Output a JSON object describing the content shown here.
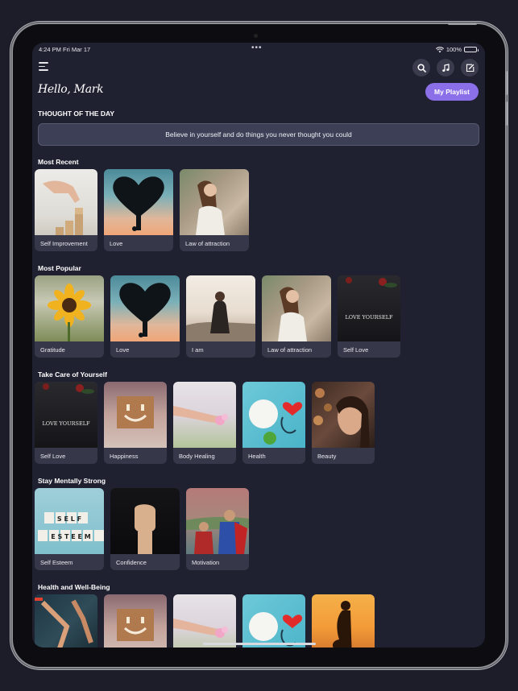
{
  "status_bar": {
    "time": "4:24 PM  Fri Mar 17",
    "dots": "•••",
    "battery": "100%"
  },
  "header": {
    "greeting": "Hello, Mark",
    "playlist_button": "My Playlist"
  },
  "thought": {
    "title": "THOUGHT OF THE DAY",
    "text": "Believe in yourself and do things you never thought you could"
  },
  "sections": [
    {
      "title": "Most Recent",
      "cards": [
        "Self Improvement",
        "Love",
        "Law of attraction"
      ]
    },
    {
      "title": "Most Popular",
      "cards": [
        "Gratitude",
        "Love",
        "I am",
        "Law of attraction",
        "Self Love"
      ]
    },
    {
      "title": "Take Care of Yourself",
      "cards": [
        "Self Love",
        "Happiness",
        "Body Healing",
        "Health",
        "Beauty"
      ]
    },
    {
      "title": "Stay Mentally Strong",
      "cards": [
        "Self Esteem",
        "Confidence",
        "Motivation"
      ]
    },
    {
      "title": "Health and Well-Being",
      "cards": [
        "",
        "",
        "",
        "",
        ""
      ]
    }
  ],
  "thumb_text": {
    "love_yourself": "LOVE YOURSELF",
    "self_row": "S E L F",
    "esteem_row": "E S T E E M"
  },
  "colors": {
    "background": "#1f2030",
    "accent": "#8b6fe8",
    "card": "#363849"
  },
  "icons": [
    "menu-icon",
    "search-icon",
    "music-note-icon",
    "edit-icon",
    "wifi-icon",
    "battery-icon"
  ]
}
